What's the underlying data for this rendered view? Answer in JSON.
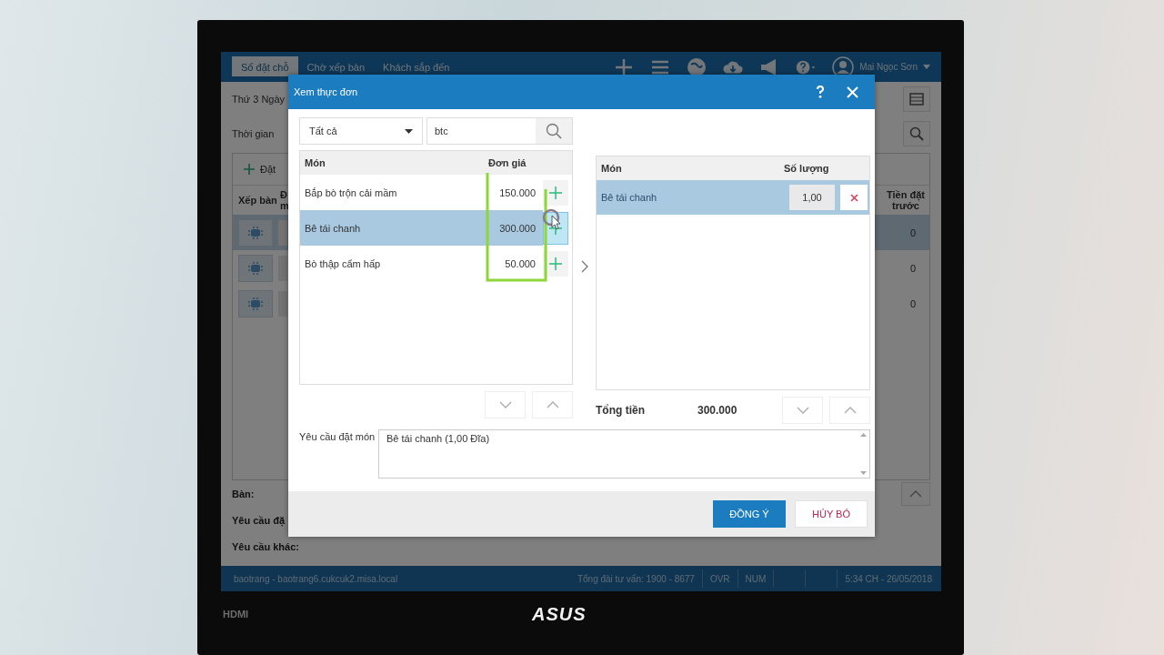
{
  "monitor": {
    "port_label": "HDMI",
    "brand": "ASUS"
  },
  "app": {
    "tabs": [
      {
        "label": "Số đặt chỗ",
        "selected": true
      },
      {
        "label": "Chờ xếp bàn",
        "selected": false
      },
      {
        "label": "Khách sắp đến",
        "selected": false
      }
    ],
    "user_name": "Mai Ngọc Sơn",
    "date_label": "Thứ 3 Ngày",
    "time_label": "Thời gian",
    "add_label": "Đặt",
    "table": {
      "columns": [
        "Xếp bàn",
        "Đ m",
        "Tiền đặt trước"
      ],
      "rows": [
        {
          "selected": true,
          "deposit": "0"
        },
        {
          "selected": false,
          "deposit": "0"
        },
        {
          "selected": false,
          "deposit": "0"
        }
      ]
    },
    "details": [
      "Bàn:",
      "Yêu cầu đặ",
      "Yêu cầu khác:"
    ],
    "status_bar": {
      "host": "baotrang - baotrang6.cukcuk2.misa.local",
      "hotline": "Tổng đài tư vấn: 1900 - 8677",
      "indicators": [
        "OVR",
        "NUM"
      ],
      "clock": "5:34 CH - 26/05/2018"
    }
  },
  "dialog": {
    "title": "Xem thực đơn",
    "filter": {
      "category": "Tất cả",
      "search": "btc"
    },
    "menu": {
      "columns": [
        "Món",
        "Đơn giá"
      ],
      "rows": [
        {
          "name": "Bắp bò trộn cải mầm",
          "price": "150.000",
          "selected": false
        },
        {
          "name": "Bê tái chanh",
          "price": "300.000",
          "selected": true
        },
        {
          "name": "Bò thập cẩm hấp",
          "price": "50.000",
          "selected": false
        }
      ]
    },
    "order": {
      "columns": [
        "Món",
        "Số lượng"
      ],
      "rows": [
        {
          "name": "Bê tái chanh",
          "quantity": "1,00",
          "selected": true
        }
      ]
    },
    "total_label": "Tổng tiền",
    "total": "300.000",
    "request_label": "Yêu cầu đặt món",
    "request": "Bê tái chanh (1,00 Đĩa)",
    "buttons": [
      {
        "label": "ĐỒNG Ý",
        "kind": "primary"
      },
      {
        "label": "HỦY BỎ",
        "kind": "cancel"
      }
    ]
  }
}
